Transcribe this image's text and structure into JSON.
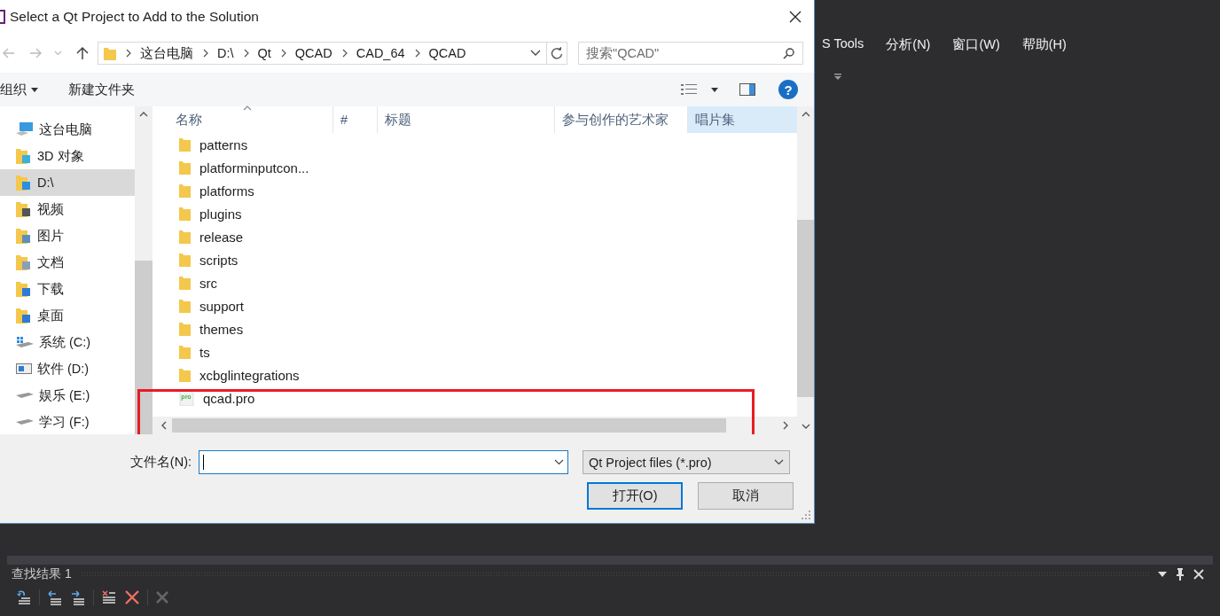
{
  "ide": {
    "menu": [
      "S Tools",
      "分析(N)",
      "窗口(W)",
      "帮助(H)"
    ],
    "output_panel": {
      "title": "查找结果 1"
    }
  },
  "dialog": {
    "title": "Select a Qt Project to Add to the Solution",
    "breadcrumbs": [
      "这台电脑",
      "D:\\",
      "Qt",
      "QCAD",
      "CAD_64",
      "QCAD"
    ],
    "search": {
      "placeholder": "搜索\"QCAD\""
    },
    "help_icon": "?",
    "toolbar": {
      "organize": "组织",
      "new_folder": "新建文件夹"
    },
    "nav_items": [
      {
        "label": "这台电脑",
        "kind": "computer",
        "selected": false
      },
      {
        "label": "3D 对象",
        "kind": "folder",
        "selected": false
      },
      {
        "label": "D:\\",
        "kind": "folder",
        "selected": true
      },
      {
        "label": "视频",
        "kind": "folder",
        "selected": false
      },
      {
        "label": "图片",
        "kind": "folder",
        "selected": false
      },
      {
        "label": "文档",
        "kind": "folder",
        "selected": false
      },
      {
        "label": "下载",
        "kind": "folder",
        "selected": false
      },
      {
        "label": "桌面",
        "kind": "folder",
        "selected": false
      },
      {
        "label": "系统 (C:)",
        "kind": "windrive",
        "selected": false
      },
      {
        "label": "软件 (D:)",
        "kind": "appdrive",
        "selected": false
      },
      {
        "label": "娱乐 (E:)",
        "kind": "drive",
        "selected": false
      },
      {
        "label": "学习 (F:)",
        "kind": "drive",
        "selected": false
      }
    ],
    "columns": [
      {
        "label": "名称",
        "sorted": true,
        "hovered": false
      },
      {
        "label": "#",
        "sorted": false,
        "hovered": false
      },
      {
        "label": "标题",
        "sorted": false,
        "hovered": false
      },
      {
        "label": "参与创作的艺术家",
        "sorted": false,
        "hovered": false
      },
      {
        "label": "唱片集",
        "sorted": false,
        "hovered": true
      }
    ],
    "files": [
      {
        "name": "patterns",
        "kind": "folder",
        "highlighted": false
      },
      {
        "name": "platforminputcon...",
        "kind": "folder",
        "highlighted": false
      },
      {
        "name": "platforms",
        "kind": "folder",
        "highlighted": false
      },
      {
        "name": "plugins",
        "kind": "folder",
        "highlighted": false
      },
      {
        "name": "release",
        "kind": "folder",
        "highlighted": false
      },
      {
        "name": "scripts",
        "kind": "folder",
        "highlighted": false
      },
      {
        "name": "src",
        "kind": "folder",
        "highlighted": false
      },
      {
        "name": "support",
        "kind": "folder",
        "highlighted": false
      },
      {
        "name": "themes",
        "kind": "folder",
        "highlighted": false
      },
      {
        "name": "ts",
        "kind": "folder",
        "highlighted": false
      },
      {
        "name": "xcbglintegrations",
        "kind": "folder",
        "highlighted": false
      },
      {
        "name": "qcad.pro",
        "kind": "pro",
        "highlighted": true
      }
    ],
    "filename_label": "文件名(N):",
    "file_type": "Qt Project files (*.pro)",
    "buttons": [
      {
        "label": "打开(O)",
        "default": true
      },
      {
        "label": "取消",
        "default": false
      }
    ]
  }
}
